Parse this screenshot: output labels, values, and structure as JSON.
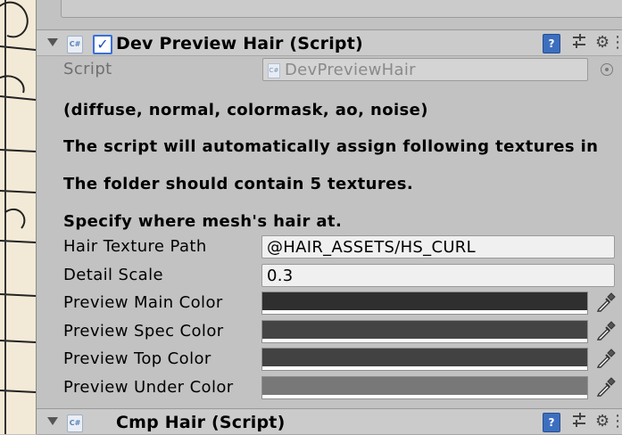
{
  "component": {
    "title": "Dev Preview Hair (Script)",
    "enabled": true,
    "icon": "csharp-script-icon",
    "script_label": "Script",
    "script_value": "DevPreviewHair",
    "help_lines": [
      "(diffuse, normal, colormask, ao, noise)",
      "The script will automatically assign following textures in",
      "The folder should contain 5 textures.",
      "Specify where mesh's hair at."
    ],
    "fields": [
      {
        "label": "Hair Texture Path",
        "value": "@HAIR_ASSETS/HS_CURL"
      },
      {
        "label": "Detail Scale",
        "value": "0.3"
      }
    ],
    "colors": [
      {
        "label": "Preview Main Color",
        "color": "#2f2f2f"
      },
      {
        "label": "Preview Spec Color",
        "color": "#444444"
      },
      {
        "label": "Preview Top Color",
        "color": "#424242"
      },
      {
        "label": "Preview Under Color",
        "color": "#787878"
      }
    ]
  },
  "next_component": {
    "title": "Cmp Hair (Script)",
    "icon": "csharp-script-icon"
  },
  "icons": {
    "help": "book-icon",
    "presets": "preset-sliders-icon",
    "settings": "gear-icon",
    "picker": "eyedropper-icon"
  }
}
